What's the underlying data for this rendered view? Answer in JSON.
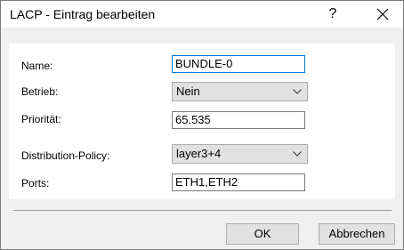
{
  "window": {
    "title": "LACP - Eintrag bearbeiten",
    "help_label": "?"
  },
  "form": {
    "name_label": "Name:",
    "name_value": "BUNDLE-0",
    "betrieb_label": "Betrieb:",
    "betrieb_value": "Nein",
    "prioritaet_label": "Priorität:",
    "prioritaet_value": "65.535",
    "policy_label": "Distribution-Policy:",
    "policy_value": "layer3+4",
    "ports_label": "Ports:",
    "ports_value": "ETH1,ETH2"
  },
  "buttons": {
    "ok_label": "OK",
    "cancel_label": "Abbrechen"
  },
  "icons": {
    "close": "close-icon",
    "dropdown": "chevron-down-icon"
  },
  "colors": {
    "focus_border": "#0078d7",
    "dialog_bg": "#f0f0f0"
  }
}
